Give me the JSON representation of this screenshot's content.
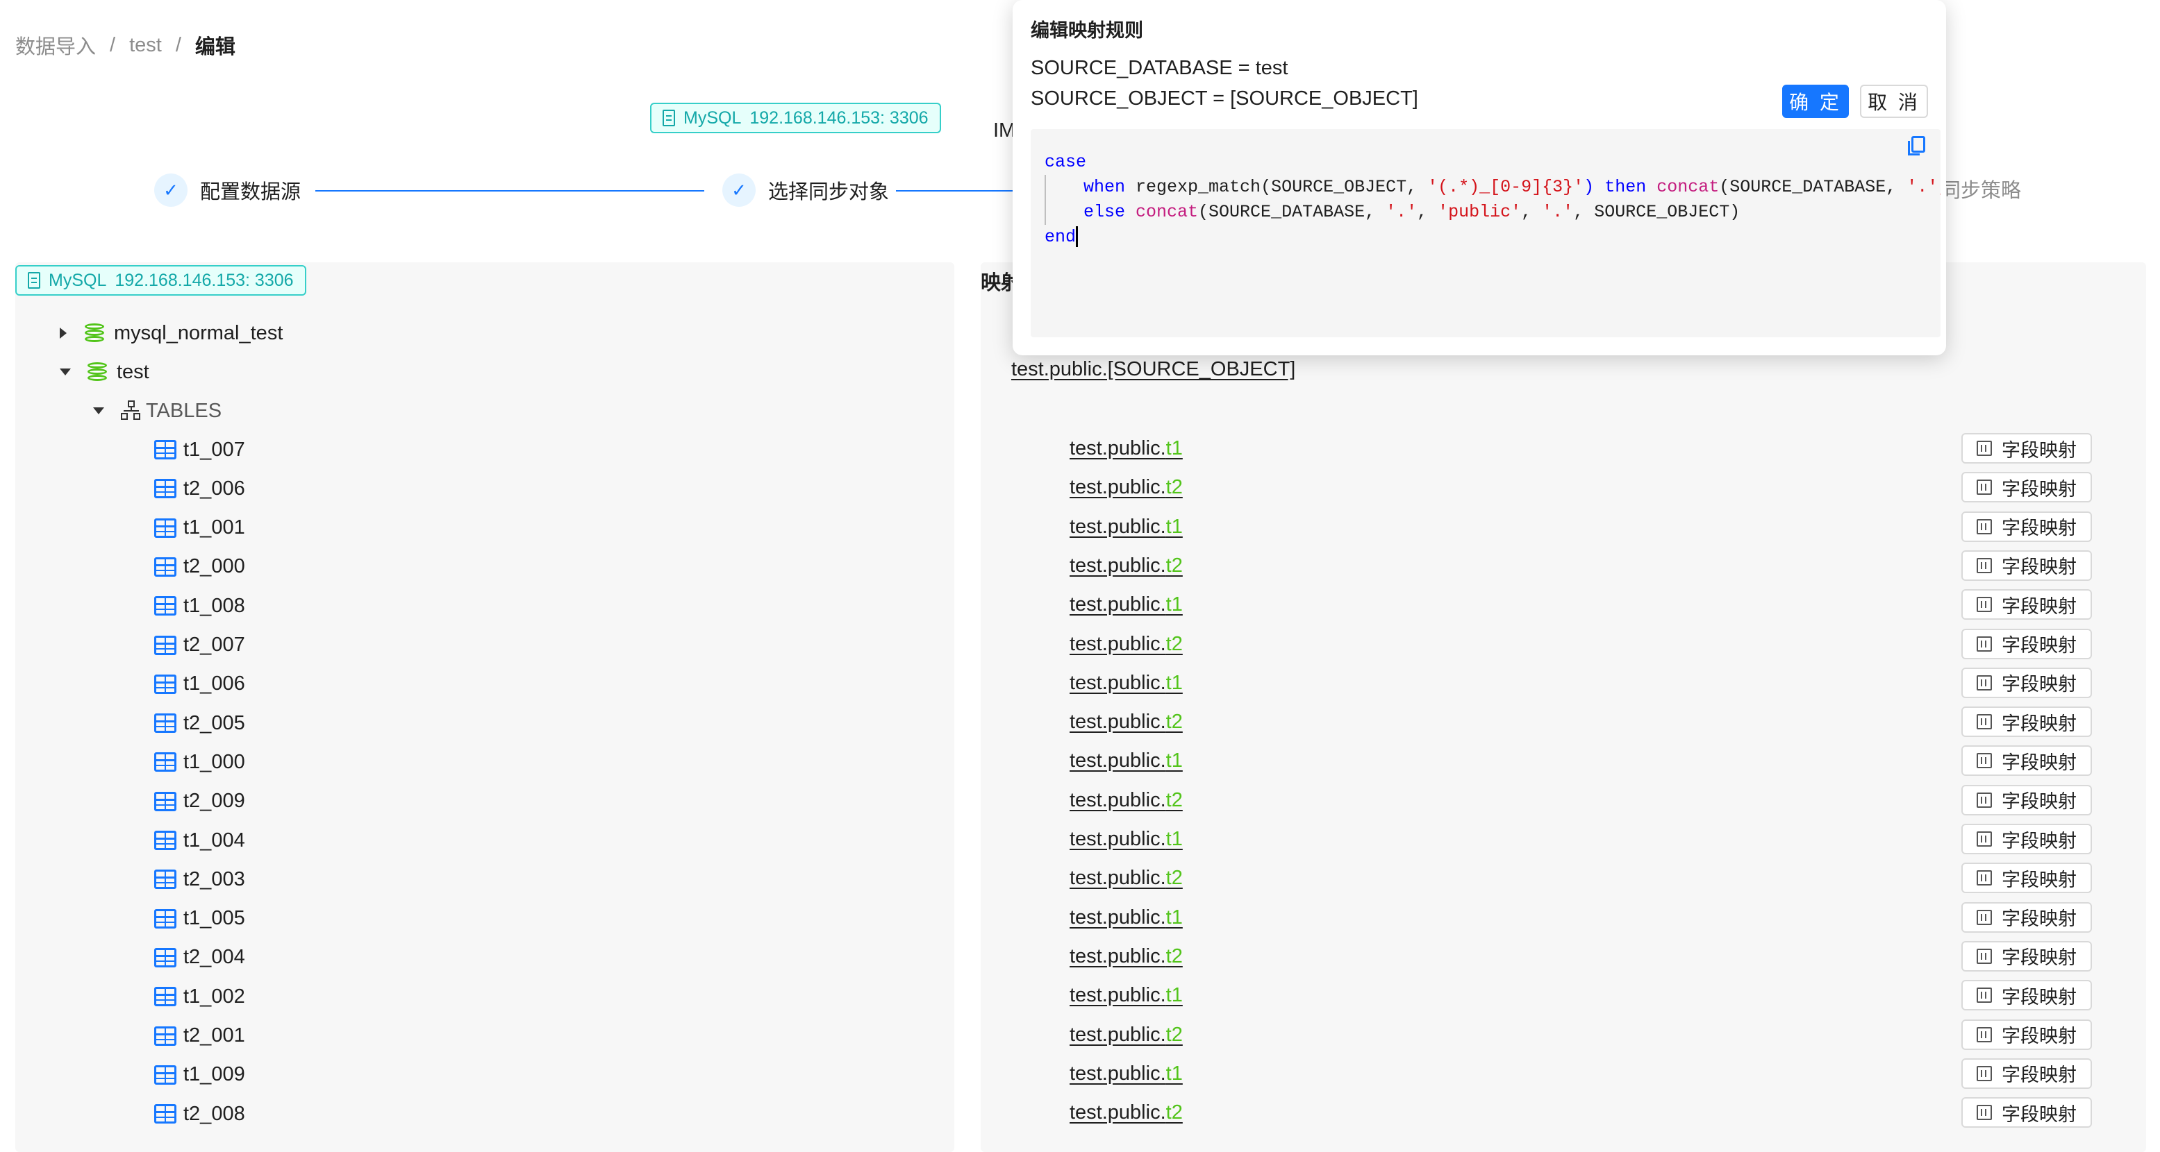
{
  "breadcrumb": {
    "item1": "数据导入",
    "item2": "test",
    "current": "编辑",
    "sep": "/"
  },
  "top_badge": {
    "type": "MySQL",
    "address": "192.168.146.153: 3306"
  },
  "im_text": "IM",
  "steps": {
    "step1": "配置数据源",
    "step2": "选择同步对象",
    "step3_partial": "同步策略",
    "check": "✓"
  },
  "left_panel": {
    "badge": {
      "type": "MySQL",
      "address": "192.168.146.153: 3306"
    },
    "databases": [
      {
        "name": "mysql_normal_test",
        "expanded": false
      },
      {
        "name": "test",
        "expanded": true
      }
    ],
    "tables_label": "TABLES",
    "tables": [
      "t1_007",
      "t2_006",
      "t1_001",
      "t2_000",
      "t1_008",
      "t2_007",
      "t1_006",
      "t2_005",
      "t1_000",
      "t2_009",
      "t1_004",
      "t2_003",
      "t1_005",
      "t2_004",
      "t1_002",
      "t2_001",
      "t1_009",
      "t2_008"
    ]
  },
  "right_panel": {
    "title_partial": "映射",
    "mapping_target": "test.public.[SOURCE_OBJECT]",
    "rows": [
      {
        "prefix": "test.public.",
        "table": "t1"
      },
      {
        "prefix": "test.public.",
        "table": "t2"
      },
      {
        "prefix": "test.public.",
        "table": "t1"
      },
      {
        "prefix": "test.public.",
        "table": "t2"
      },
      {
        "prefix": "test.public.",
        "table": "t1"
      },
      {
        "prefix": "test.public.",
        "table": "t2"
      },
      {
        "prefix": "test.public.",
        "table": "t1"
      },
      {
        "prefix": "test.public.",
        "table": "t2"
      },
      {
        "prefix": "test.public.",
        "table": "t1"
      },
      {
        "prefix": "test.public.",
        "table": "t2"
      },
      {
        "prefix": "test.public.",
        "table": "t1"
      },
      {
        "prefix": "test.public.",
        "table": "t2"
      },
      {
        "prefix": "test.public.",
        "table": "t1"
      },
      {
        "prefix": "test.public.",
        "table": "t2"
      },
      {
        "prefix": "test.public.",
        "table": "t1"
      },
      {
        "prefix": "test.public.",
        "table": "t2"
      },
      {
        "prefix": "test.public.",
        "table": "t1"
      },
      {
        "prefix": "test.public.",
        "table": "t2"
      }
    ],
    "field_mapping_label": "字段映射"
  },
  "popover": {
    "title": "编辑映射规则",
    "line1": "SOURCE_DATABASE = test",
    "line2": "SOURCE_OBJECT = [SOURCE_OBJECT]",
    "ok_label": "确 定",
    "cancel_label": "取 消",
    "code": {
      "l1_kw": "case",
      "l2_when": "when",
      "l2_fn1": "regexp_match",
      "l2_args": "(SOURCE_OBJECT, ",
      "l2_str": "'(.*)_[0-9]{3}'",
      "l2_close": ")",
      "l2_then": "then",
      "l2_fn2": "concat",
      "l2_rest": "(SOURCE_DATABASE, ",
      "l2_str2": "'.'",
      "l2_tail": ", '",
      "l3_else": "else",
      "l3_fn": "concat",
      "l3_args": "(SOURCE_DATABASE, ",
      "l3_s1": "'.'",
      "l3_s2": "'public'",
      "l3_s3": "'.'",
      "l3_end": ", SOURCE_OBJECT)",
      "l4_kw": "end"
    }
  }
}
